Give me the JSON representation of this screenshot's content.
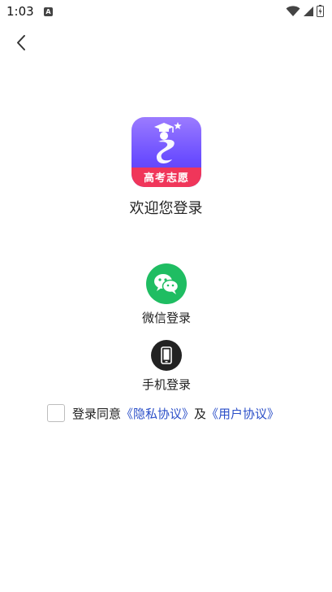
{
  "status": {
    "time": "1:03",
    "notification_letter": "A"
  },
  "logo": {
    "band_text": "高考志愿"
  },
  "welcome_text": "欢迎您登录",
  "login_options": {
    "wechat_label": "微信登录",
    "phone_label": "手机登录"
  },
  "agreement": {
    "prefix": "登录同意",
    "privacy_link": "《隐私协议》",
    "joiner": "及",
    "user_link": "《用户协议》"
  },
  "colors": {
    "wechat_green": "#1fbd62",
    "link_blue": "#2b4fc8",
    "logo_purple": "#6a4dff",
    "logo_red": "#f0365a"
  }
}
